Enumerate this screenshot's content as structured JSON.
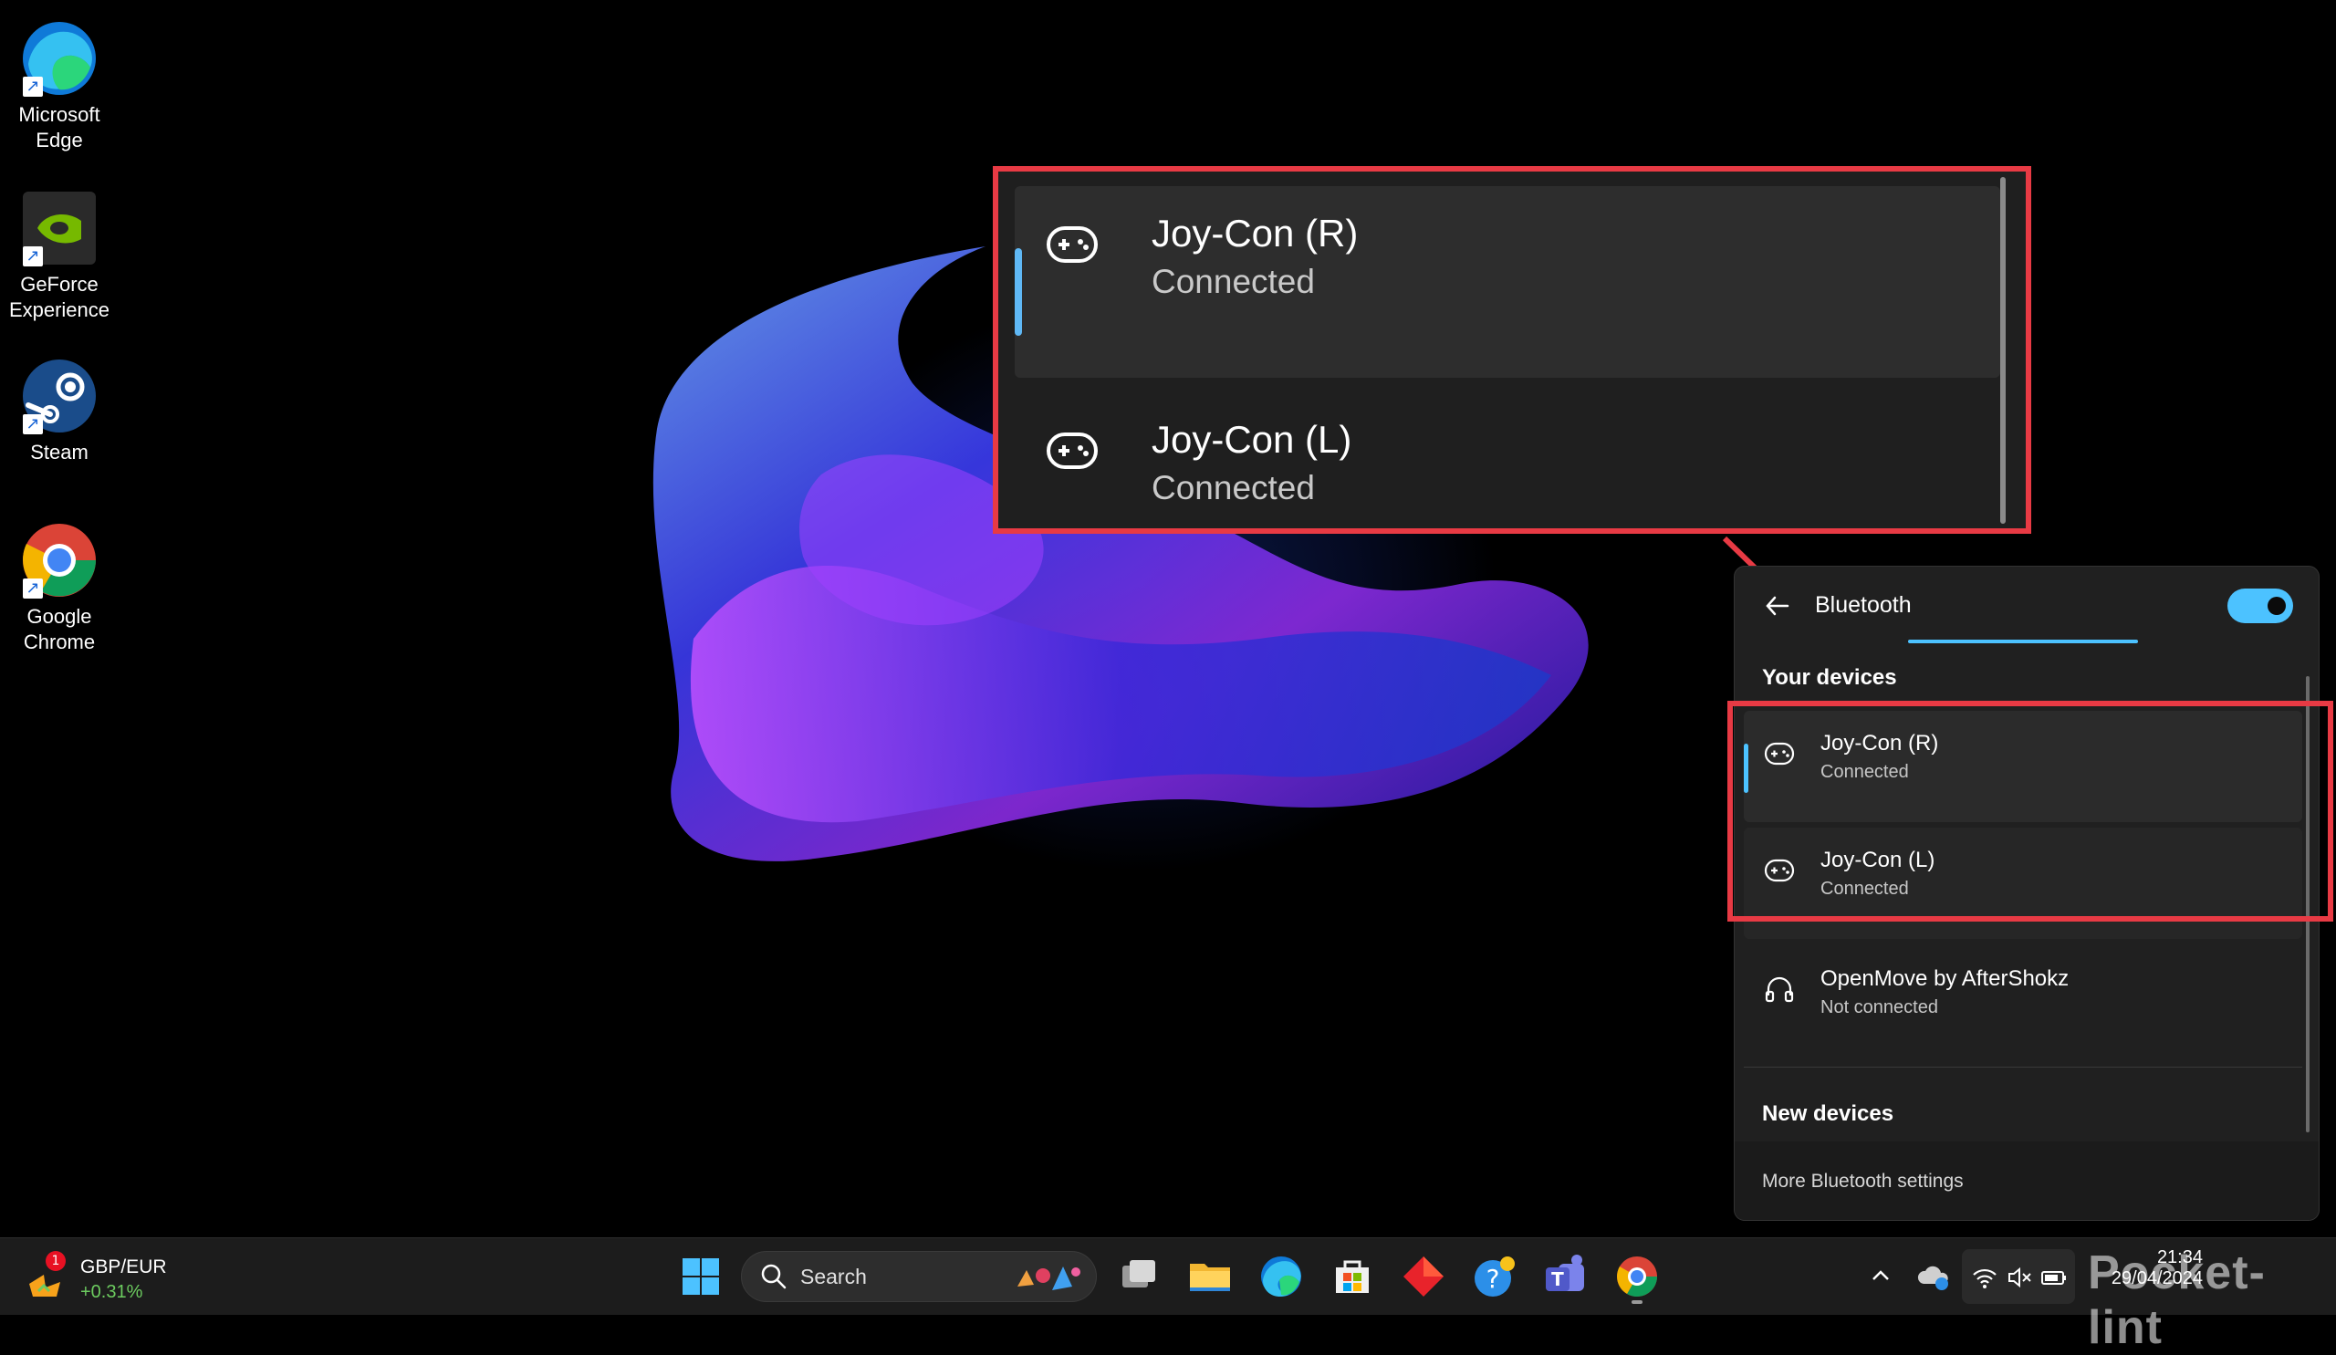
{
  "desktop": {
    "icons": [
      {
        "label": "Microsoft\nEdge",
        "line1": "Microsoft",
        "line2": "Edge",
        "icon": "edge-icon"
      },
      {
        "label": "GeForce Experience",
        "line1": "GeForce",
        "line2": "Experience",
        "icon": "geforce-icon"
      },
      {
        "label": "Steam",
        "line1": "Steam",
        "line2": "",
        "icon": "steam-icon"
      },
      {
        "label": "Google Chrome",
        "line1": "Google",
        "line2": "Chrome",
        "icon": "chrome-icon"
      }
    ]
  },
  "zoom": {
    "devices": [
      {
        "name": "Joy-Con (R)",
        "status": "Connected"
      },
      {
        "name": "Joy-Con (L)",
        "status": "Connected"
      }
    ]
  },
  "bluetooth": {
    "title": "Bluetooth",
    "toggle_on": true,
    "your_devices_label": "Your devices",
    "devices": [
      {
        "name": "Joy-Con (R)",
        "status": "Connected",
        "icon": "gamepad-icon"
      },
      {
        "name": "Joy-Con (L)",
        "status": "Connected",
        "icon": "gamepad-icon"
      },
      {
        "name": "OpenMove by AfterShokz",
        "status": "Not connected",
        "icon": "headphones-icon"
      }
    ],
    "new_devices_label": "New devices",
    "more_settings": "More Bluetooth settings"
  },
  "taskbar": {
    "widget": {
      "name": "GBP/EUR",
      "change": "+0.31%",
      "badge": "1"
    },
    "search_placeholder": "Search",
    "clock": {
      "time": "21:34",
      "date": "29/04/2024"
    },
    "watermark": "Pocket-lint"
  },
  "colors": {
    "accent": "#4cc2ff",
    "highlight": "#e83a44",
    "panel": "#202020",
    "taskbar": "#1c1c1c"
  }
}
